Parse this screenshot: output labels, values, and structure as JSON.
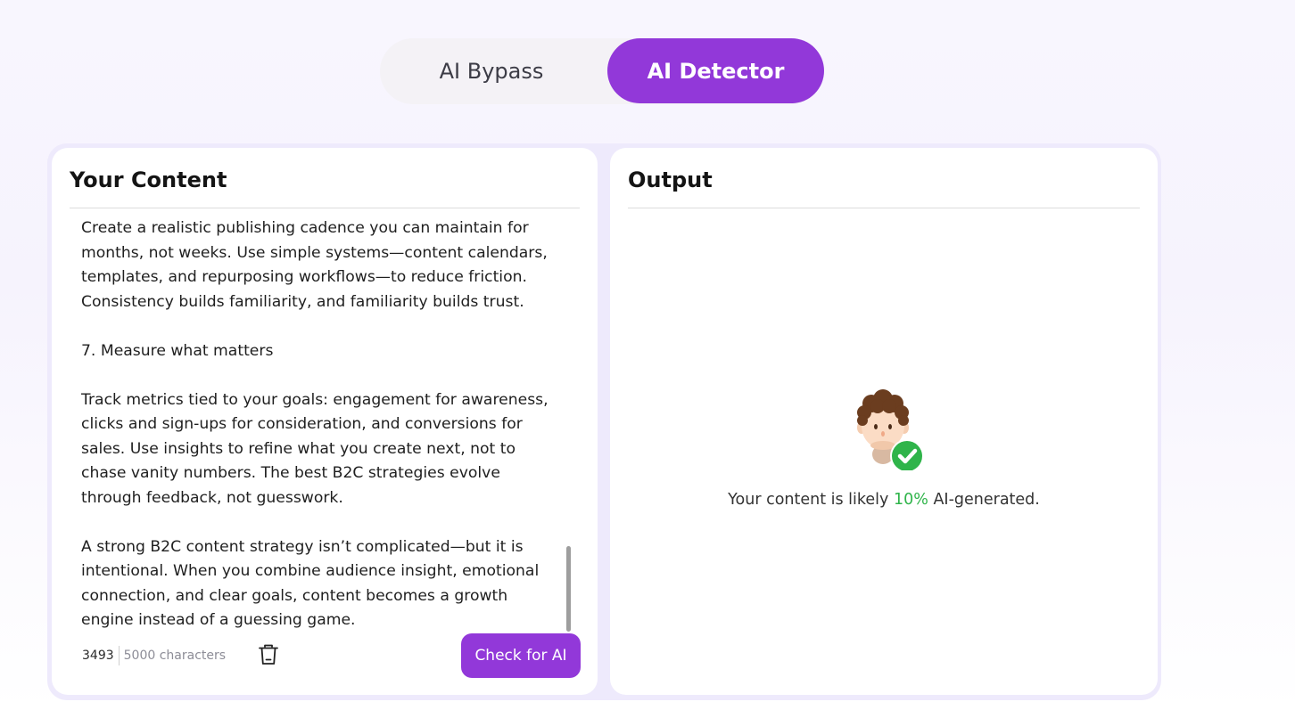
{
  "tabs": [
    {
      "label": "AI Bypass",
      "active": false
    },
    {
      "label": "AI Detector",
      "active": true
    }
  ],
  "input_panel": {
    "title": "Your Content",
    "paragraphs": [
      "Create a realistic publishing cadence you can maintain for months, not weeks. Use simple systems—content calendars, templates, and repurposing workflows—to reduce friction. Consistency builds familiarity, and familiarity builds trust.",
      "7. Measure what matters",
      "Track metrics tied to your goals: engagement for awareness, clicks and sign-ups for consideration, and conversions for sales. Use insights to refine what you create next, not to chase vanity numbers. The best B2C strategies evolve through feedback, not guesswork.",
      "A strong B2C content strategy isn’t complicated—but it is intentional. When you combine audience insight, emotional connection, and clear goals, content becomes a growth engine instead of a guessing game."
    ],
    "char_count": "3493",
    "char_limit": "5000 characters",
    "clear_icon": "trash-icon",
    "check_button": "Check for AI"
  },
  "output_panel": {
    "title": "Output",
    "illustration": "avatar-check-icon",
    "result_prefix": "Your content is likely ",
    "result_percent": "10%",
    "result_suffix": " AI-generated."
  },
  "colors": {
    "accent": "#9238d9",
    "result_green": "#2fb44a",
    "frame": "#eeeafc"
  }
}
